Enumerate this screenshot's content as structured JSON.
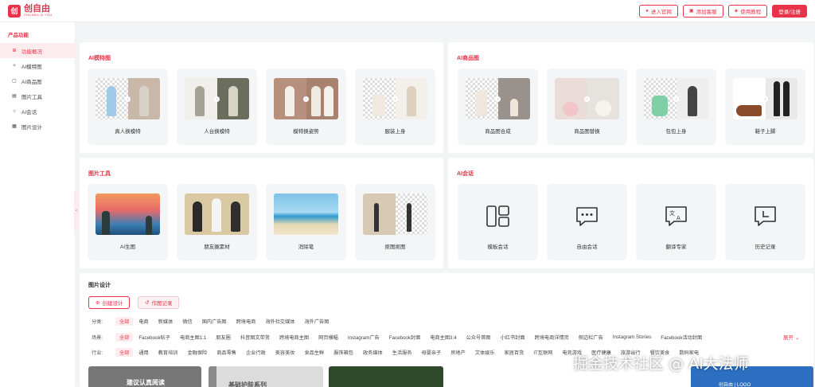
{
  "header": {
    "logo_mark": "创",
    "logo_name": "创自由",
    "logo_sub": "CHUANG ZI YOU",
    "buttons": [
      {
        "label": "进入官网",
        "icon": "chat-icon"
      },
      {
        "label": "添加客服",
        "icon": "bag-icon"
      },
      {
        "label": "使用教程",
        "icon": "gift-icon"
      },
      {
        "label": "登录/注册",
        "icon": ""
      }
    ]
  },
  "sidebar": {
    "title": "产品功能",
    "items": [
      {
        "label": "功能概况",
        "icon": "grid-icon",
        "active": true
      },
      {
        "label": "AI模特图",
        "icon": "sparkle-icon",
        "active": false
      },
      {
        "label": "AI商品图",
        "icon": "image-icon",
        "active": false
      },
      {
        "label": "图片工具",
        "icon": "tool-icon",
        "active": false
      },
      {
        "label": "AI会话",
        "icon": "chat-icon",
        "active": false
      },
      {
        "label": "图片设计",
        "icon": "design-icon",
        "active": false
      }
    ]
  },
  "sections": {
    "model": {
      "title": "AI模特图",
      "tiles": [
        "真人换模特",
        "人台换模特",
        "模特换姿势",
        "服装上身"
      ]
    },
    "product": {
      "title": "AI商品图",
      "tiles": [
        "商品图合成",
        "商品图替换",
        "包包上身",
        "鞋子上脚"
      ]
    },
    "tools": {
      "title": "图片工具",
      "tiles": [
        "AI生图",
        "朋友圈素材",
        "消除笔",
        "抠图抠图"
      ]
    },
    "chat": {
      "title": "AI会话",
      "tiles": [
        "模板会话",
        "自由会话",
        "翻译专家",
        "历史记录"
      ]
    }
  },
  "design": {
    "title": "图片设计",
    "create_label": "创建设计",
    "history_label": "作图记录",
    "expand_label": "展开",
    "rows": [
      {
        "label": "分类:",
        "options": [
          "全部",
          "电商",
          "新媒体",
          "微信",
          "国内广告图",
          "跨境电商",
          "海外社交媒体",
          "海外广告图"
        ]
      },
      {
        "label": "场景:",
        "options": [
          "全部",
          "Facebook帖子",
          "电商主图1:1",
          "朋友圈",
          "抖音图文带货",
          "跨境电商主图",
          "网页横幅",
          "Instagram广告",
          "Facebook封面",
          "电商主图3:4",
          "公众号首图",
          "小红书封面",
          "跨境电商详情页",
          "侧边栏广告",
          "Instagram Stories",
          "Facebook活动封面"
        ]
      },
      {
        "label": "行业:",
        "options": [
          "全部",
          "通用",
          "教育培训",
          "金融保险",
          "商品零售",
          "企业行政",
          "美容美妆",
          "食品生鲜",
          "服饰箱包",
          "政务媒体",
          "生活服务",
          "母婴亲子",
          "房地产",
          "文体娱乐",
          "家居百货",
          "IT互联网",
          "电竞游戏",
          "医疗健康",
          "旅游出行",
          "餐饮美食",
          "数码家电"
        ]
      }
    ],
    "previews": [
      "建议认真阅读",
      "基础护肤系列",
      "创自由 | LOGO"
    ]
  },
  "watermark": "掘金技术社区 @ AI大法师",
  "colors": {
    "accent": "#e8334a",
    "tile_bg": "#f4f5f7",
    "page_bg": "#f3f4f6"
  }
}
